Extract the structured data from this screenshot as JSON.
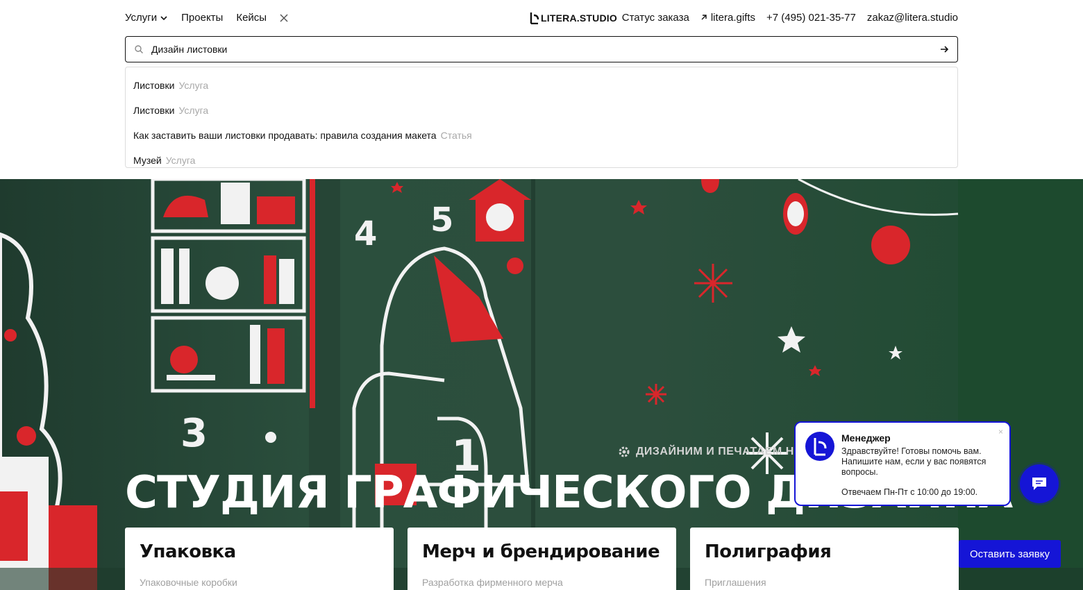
{
  "nav": {
    "left": [
      "Услуги",
      "Проекты",
      "Кейсы"
    ],
    "right": {
      "order_status": "Статус заказа",
      "gifts_link": "litera.gifts",
      "phone": "+7 (495) 021-35-77",
      "email": "zakaz@litera.studio"
    },
    "logo_text": "LITERA.STUDIO"
  },
  "search": {
    "value": "Дизайн листовки",
    "icon": "search-icon",
    "submit_icon": "arrow-right-icon"
  },
  "suggestions": [
    {
      "title": "Листовки",
      "type": "Услуга"
    },
    {
      "title": "Листовки",
      "type": "Услуга"
    },
    {
      "title": "Как заставить ваши листовки продавать: правила создания макета",
      "type": "Статья"
    },
    {
      "title": "Музей",
      "type": "Услуга"
    }
  ],
  "hero": {
    "tagline": "ДИЗАЙНИМ И ПЕЧАТАЕМ Н",
    "title": "СТУДИЯ ГРАФИЧЕСКОГО ДИЗАЙНА",
    "background_color": "#2a4d3c"
  },
  "cards": [
    {
      "title": "Упаковка",
      "sub": "Упаковочные коробки"
    },
    {
      "title": "Мерч и брендирование",
      "sub": "Разработка фирменного мерча"
    },
    {
      "title": "Полиграфия",
      "sub": "Приглашения"
    }
  ],
  "chat": {
    "name": "Менеджер",
    "message": "Здравствуйте! Готовы помочь вам. Напишите нам, если у вас появятся вопросы.",
    "hours": "Отвечаем Пн-Пт с 10:00 до 19:00.",
    "close": "×"
  },
  "request_button": "Оставить заявку",
  "colors": {
    "accent": "#1515d6",
    "hero_green": "#2a4d3c",
    "ornament_red": "#d9262b"
  }
}
